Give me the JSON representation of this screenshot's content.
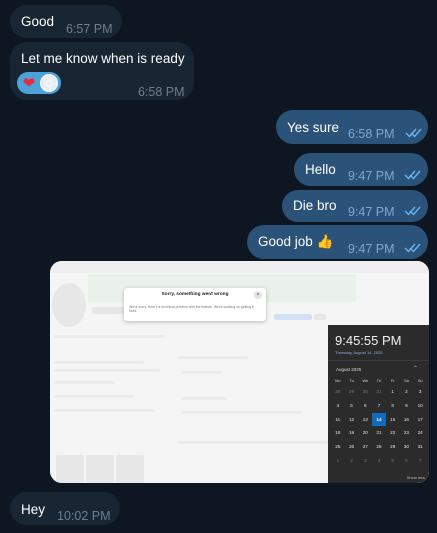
{
  "messages": [
    {
      "text": "Good",
      "time": "6:57 PM",
      "dir": "in"
    },
    {
      "text": "Let me know when is ready",
      "time": "6:58 PM",
      "dir": "in",
      "reactions": [
        {
          "icon": "heart-icon",
          "glyph": "❤"
        },
        {
          "icon": "reactor-avatar-icon",
          "glyph": "☺"
        }
      ]
    },
    {
      "text": "Yes sure",
      "time": "6:58 PM",
      "dir": "out",
      "status": "read"
    },
    {
      "text": "Hello",
      "time": "9:47 PM",
      "dir": "out",
      "status": "read"
    },
    {
      "text": "Die bro",
      "time": "9:47 PM",
      "dir": "out",
      "status": "read"
    },
    {
      "text": "Good job 👍",
      "time": "9:47 PM",
      "dir": "out",
      "status": "read"
    },
    {
      "text": "Hey",
      "time": "10:02 PM",
      "dir": "in"
    }
  ],
  "screenshot": {
    "dialog": {
      "title": "Sorry, something went wrong",
      "body": "We're sorry. Here's a technical problem with the feature. We're working on getting it fixed.",
      "close_glyph": "×"
    },
    "clock": {
      "time": "9:45:55 PM",
      "date": "Thursday, August 14, 2025",
      "month": "August 2025",
      "up_glyph": "⌃",
      "weekdays": [
        "Mo",
        "Tu",
        "We",
        "Th",
        "Fr",
        "Sa",
        "Su"
      ],
      "days": [
        "28",
        "29",
        "30",
        "31",
        "1",
        "2",
        "3",
        "4",
        "5",
        "6",
        "7",
        "8",
        "9",
        "10",
        "11",
        "12",
        "13",
        "14",
        "15",
        "16",
        "17",
        "18",
        "19",
        "20",
        "21",
        "22",
        "23",
        "24",
        "25",
        "26",
        "27",
        "28",
        "29",
        "30",
        "31",
        "1",
        "2",
        "3",
        "4",
        "5",
        "6",
        "7"
      ],
      "selected": "14",
      "show_more": "Show less"
    }
  },
  "colors": {
    "background": "#0e1621",
    "incoming_bubble": "#182533",
    "outgoing_bubble": "#2b5278",
    "read_ticks": "#6ab3f3"
  }
}
